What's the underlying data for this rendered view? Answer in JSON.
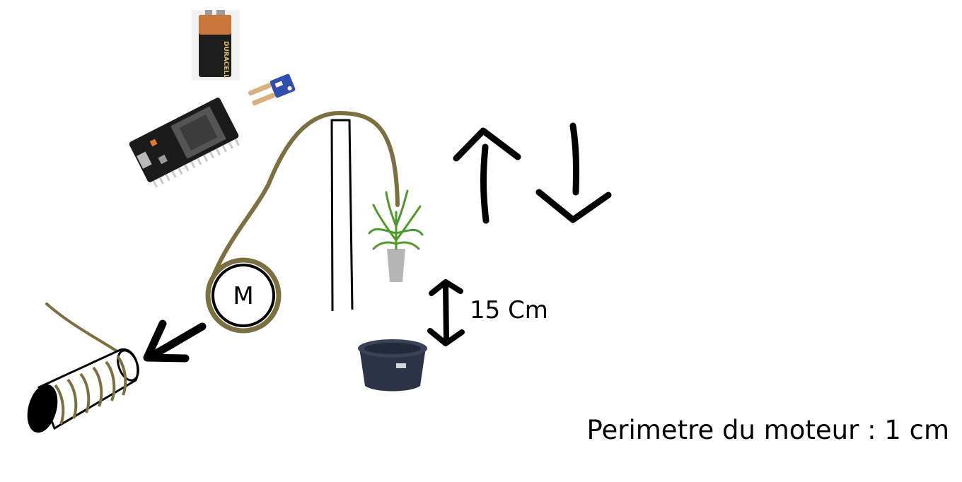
{
  "labels": {
    "motor": "M",
    "distance": "15 Cm",
    "perimeter": "Perimetre du moteur : 1 cm",
    "battery_brand": "DURACELL"
  },
  "colors": {
    "string": "#7a7040",
    "ink": "#000000",
    "battery_copper": "#c8763a",
    "battery_black": "#1e1e1e",
    "board_black": "#1b1b1b",
    "sensor_blue": "#2f4fb0",
    "plant_green": "#4c9a2a",
    "pot_grey": "#b5b5b5",
    "tank_navy": "#2c3347"
  },
  "components": [
    {
      "name": "9V battery",
      "icon": "battery-icon"
    },
    {
      "name": "soil moisture sensor",
      "icon": "soil-sensor-icon"
    },
    {
      "name": "ESP32 board",
      "icon": "esp32-board-icon"
    },
    {
      "name": "motor",
      "icon": "motor-icon"
    },
    {
      "name": "spool",
      "icon": "spool-icon"
    },
    {
      "name": "pole",
      "icon": "pole-icon"
    },
    {
      "name": "plant",
      "icon": "plant-icon"
    },
    {
      "name": "water tank",
      "icon": "water-tank-icon"
    },
    {
      "name": "up arrow",
      "icon": "arrow-up-icon"
    },
    {
      "name": "down arrow",
      "icon": "arrow-down-icon"
    },
    {
      "name": "double arrow",
      "icon": "double-arrow-icon"
    },
    {
      "name": "arrow to spool",
      "icon": "arrow-to-spool-icon"
    }
  ]
}
